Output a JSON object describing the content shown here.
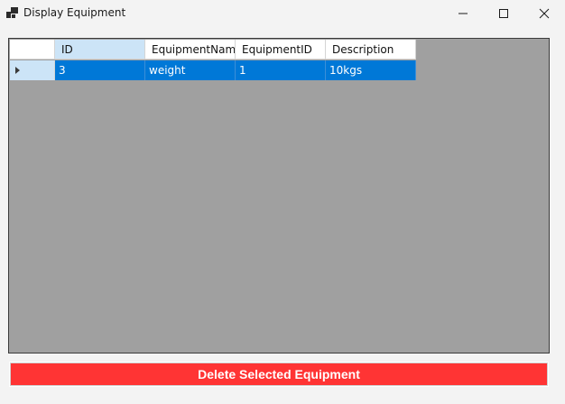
{
  "window": {
    "title": "Display Equipment"
  },
  "grid": {
    "columns": [
      "ID",
      "EquipmentName",
      "EquipmentID",
      "Description"
    ],
    "rows": [
      {
        "id": "3",
        "equipment_name": "weight",
        "equipment_id": "1",
        "description": "10kgs"
      }
    ]
  },
  "actions": {
    "delete_label": "Delete Selected Equipment"
  },
  "colors": {
    "selection": "#0078d7",
    "delete_button": "#ff3434",
    "grid_background": "#a0a0a0"
  },
  "icons": [
    "app-icon",
    "minimize-icon",
    "maximize-icon",
    "close-icon",
    "row-selector-arrow-icon"
  ]
}
